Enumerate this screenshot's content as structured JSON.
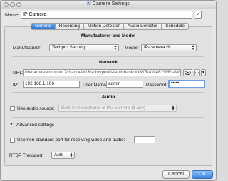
{
  "window": {
    "title": "Camera Settings",
    "app_icon": "iV"
  },
  "name": {
    "label": "Name:",
    "value": "IP Camera"
  },
  "tabs": [
    {
      "label": "General",
      "active": true
    },
    {
      "label": "Recording",
      "active": false
    },
    {
      "label": "Motion Detector",
      "active": false
    },
    {
      "label": "Audio Detector",
      "active": false
    },
    {
      "label": "Schedule",
      "active": false
    }
  ],
  "manufacturer": {
    "section_title": "Manufacturer and Model",
    "manufacturer_label": "Manufacturer:",
    "manufacturer_value": "Techpro Security",
    "model_label": "Model:",
    "model_value": "IP-camera HI"
  },
  "network": {
    "section_title": "Network",
    "url_label": "URL:",
    "url_value": "06/cam/realmonitor?channel=1&subtype=0&authbasic=YWRtaW46YWRtaW4=",
    "more_button": "...",
    "ip_label": "IP:",
    "ip_value": "192.168.1.106",
    "username_label": "User Name:",
    "username_value": "admin",
    "password_label": "Password:",
    "password_value": "•••••"
  },
  "audio": {
    "section_title": "Audio",
    "use_audio_label": "Use audio source:",
    "audio_source_value": "Built-in microphone of this camera (if any)"
  },
  "advanced": {
    "toggle_label": "Advanced settings",
    "nonstandard_port_label": "Use non-standard port for receiving video and audio:",
    "rtsp_label": "RTSP Transport:",
    "rtsp_value": "Auto"
  },
  "buttons": {
    "cancel": "Cancel",
    "ok": "OK"
  },
  "colors": {
    "accent": "#3d84dc",
    "focus_ring": "#6d9fe0"
  }
}
